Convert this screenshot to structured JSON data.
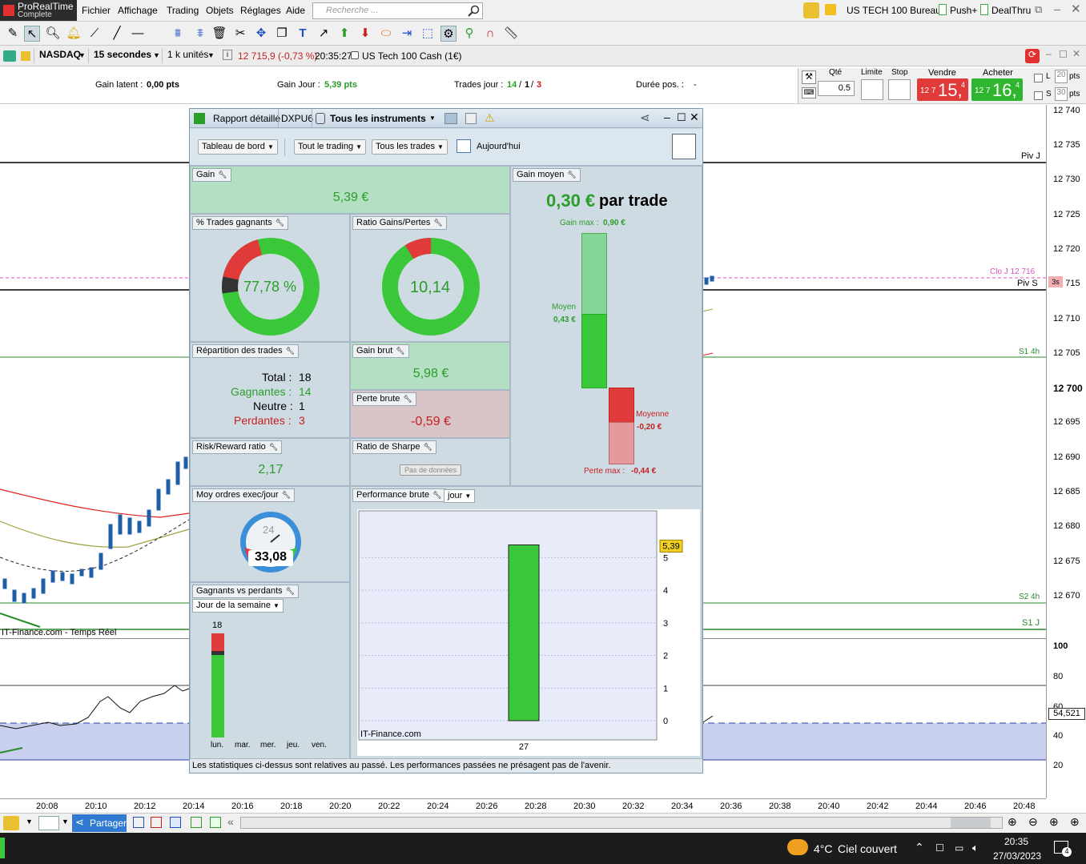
{
  "app": {
    "logo_line1": "ProRealTime",
    "logo_line2": "Complete"
  },
  "menu": [
    "Fichier",
    "Affichage",
    "Trading",
    "Objets",
    "Réglages",
    "Aide"
  ],
  "search": {
    "placeholder": "Recherche ..."
  },
  "topright": {
    "workspace": "US TECH 100 Bureau",
    "push": "Push+",
    "dealthru": "DealThru"
  },
  "instrument": {
    "market": "NASDAQ",
    "period": "15 secondes",
    "units": "1 k unités",
    "price": "12 715,9 (-0,73 %)",
    "time": "20:35:27",
    "name": "US Tech 100 Cash (1€)"
  },
  "info": {
    "gain_latent_label": "Gain latent :",
    "gain_latent": "0,00 pts",
    "gain_jour_label": "Gain Jour :",
    "gain_jour": "5,39 pts",
    "trades_jour_label": "Trades jour :",
    "trades_jour_a": "14",
    "trades_jour_b": "1",
    "trades_jour_c": "3",
    "duree_label": "Durée pos. :",
    "duree": "-"
  },
  "order": {
    "qte_label": "Qté",
    "qte": "0.5",
    "limite": "Limite",
    "stop": "Stop",
    "vendre": "Vendre",
    "acheter": "Acheter",
    "sell_small": "12 7",
    "sell_big": "15,",
    "sell_sup": "4",
    "buy_small": "12 7",
    "buy_big": "16,",
    "buy_sup": "4",
    "l_label": "L",
    "l_val": "20",
    "s_label": "S",
    "s_val": "30",
    "pts": "pts"
  },
  "yaxis": [
    "12 740",
    "12 735",
    "12 730",
    "12 725",
    "12 720",
    "12 715",
    "12 710",
    "12 705",
    "12 700",
    "12 695",
    "12 690",
    "12 685",
    "12 680",
    "12 675",
    "12 670"
  ],
  "rsi_axis": [
    "100",
    "80",
    "60",
    "40",
    "20"
  ],
  "rsi_value": "54,521",
  "chart_labels": {
    "piv_j": "Piv J",
    "clo_j": "Clo J 12 716",
    "piv_s": "Piv S",
    "tag3s": "3s",
    "s1_4h": "S1 4h",
    "s2_4h": "S2 4h",
    "s1_j": "S1 J",
    "source": "IT-Finance.com - Temps Réel"
  },
  "xaxis": [
    "20:08",
    "20:10",
    "20:12",
    "20:14",
    "20:16",
    "20:18",
    "20:20",
    "20:22",
    "20:24",
    "20:26",
    "20:28",
    "20:30",
    "20:32",
    "20:34",
    "20:36",
    "20:38",
    "20:40",
    "20:42",
    "20:44",
    "20:46",
    "20:48"
  ],
  "panel": {
    "tab1": "Rapport détaillé",
    "tab2": "DXPU6",
    "tab3": "Tous les instruments",
    "btn_dashboard": "Tableau de bord",
    "btn_trading": "Tout le trading",
    "btn_trades": "Tous les trades",
    "btn_today": "Aujourd'hui",
    "gain_title": "Gain",
    "gain": "5,39 €",
    "gain_moyen_title": "Gain moyen",
    "gain_moyen": "0,30 €",
    "par_trade": "par trade",
    "gain_max_label": "Gain max :",
    "gain_max": "0,90 €",
    "moyen_label": "Moyen",
    "moyen": "0,43 €",
    "moyenne_label": "Moyenne",
    "moyenne": "-0,20 €",
    "perte_max_label": "Perte max :",
    "perte_max": "-0,44 €",
    "pct_title": "% Trades gagnants",
    "pct": "77,78 %",
    "ratio_title": "Ratio Gains/Pertes",
    "ratio": "10,14",
    "rep_title": "Répartition des trades",
    "total_label": "Total :",
    "total": "18",
    "gagnantes_label": "Gagnantes :",
    "gagnantes": "14",
    "neutre_label": "Neutre :",
    "neutre": "1",
    "perdantes_label": "Perdantes :",
    "perdantes": "3",
    "gain_brut_title": "Gain brut",
    "gain_brut": "5,98 €",
    "perte_brute_title": "Perte brute",
    "perte_brute": "-0,59 €",
    "rr_title": "Risk/Reward ratio",
    "rr": "2,17",
    "sharpe_title": "Ratio de Sharpe",
    "sharpe_btn": "Pas de données",
    "moy_title": "Moy ordres exec/jour",
    "moy_hours": "24",
    "moy": "33,08",
    "perf_title": "Performance brute",
    "perf_period": "jour",
    "perf_value_tag": "5,39",
    "perf_source": "IT-Finance.com",
    "perf_x": "27",
    "gvp_title": "Gagnants vs perdants",
    "gvp_select": "Jour de la semaine",
    "gvp_total": "18",
    "days": [
      "lun.",
      "mar.",
      "mer.",
      "jeu.",
      "ven."
    ],
    "footer": "Les statistiques ci-dessus sont relatives au passé. Les performances passées ne présagent pas de l'avenir."
  },
  "bottom": {
    "share": "Partager"
  },
  "taskbar": {
    "temp": "4°C",
    "weather": "Ciel couvert",
    "time": "20:35",
    "date": "27/03/2023",
    "notif": "4"
  },
  "colors": {
    "green": "#2a9d2a",
    "red": "#e03a3a",
    "panel_bg": "#cfdbe2"
  },
  "chart_data": {
    "type": "bar",
    "categories": [
      "27"
    ],
    "values": [
      5.39
    ],
    "ylim": [
      0,
      5.5
    ],
    "yticks": [
      0,
      1,
      2,
      3,
      4,
      5
    ]
  }
}
